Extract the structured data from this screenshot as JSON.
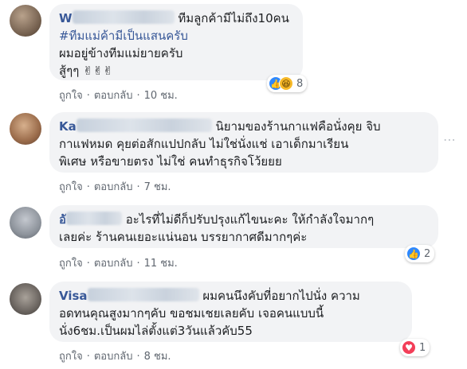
{
  "comments": [
    {
      "name": "W",
      "lines": [
        "ทีมลูกค้ามีไม่ถึง10คน",
        "#ทีมแม่ค้ามีเป็นแสนครับ",
        "ผมอยู่ข้างทีมแม่ยายครับ",
        "สู้ๆๆ ✌✌✌"
      ],
      "actions": {
        "like": "ถูกใจ",
        "reply": "ตอบกลับ",
        "time": "10 ชม."
      },
      "reactions": {
        "icons": [
          "like-icon",
          "haha-icon"
        ],
        "count": "8"
      }
    },
    {
      "name": "Ka",
      "lines": [
        "นิยามของร้านกาแฟคือนั่งคุย จิบ",
        "กาแฟหมด คุยต่อสักแปปกลับ ไม่ใช่นั่งแช่ เอาเด็กมาเรียน",
        "พิเศษ หรือขายตรง ไม่ใช่ คนทำธุรกิจโว้ยยย"
      ],
      "actions": {
        "like": "ถูกใจ",
        "reply": "ตอบกลับ",
        "time": "7 ชม."
      }
    },
    {
      "name": "อั",
      "lines": [
        "อะไรที่ไม่ดีก็ปรับปรุงแก้ไขนะคะ ให้กำลังใจมากๆ",
        "เลยค่ะ ร้านคนเยอะแน่นอน บรรยากาศดีมากๆค่ะ"
      ],
      "actions": {
        "like": "ถูกใจ",
        "reply": "ตอบกลับ",
        "time": "11 ชม."
      },
      "reactions": {
        "icons": [
          "like-icon"
        ],
        "count": "2"
      }
    },
    {
      "name": "Visa",
      "lines": [
        "ผมคนนึงคับที่อยากไปนั่ง ความ",
        "อดทนคุณสูงมากๆคับ ขอชมเชยเลยคับ เจอคนแบบนี้",
        "นั่ง6ชม.เป็นผมไล่ตั้งแต่3วันแล้วคับ55"
      ],
      "actions": {
        "like": "ถูกใจ",
        "reply": "ตอบกลับ",
        "time": "8 ชม."
      },
      "reactions": {
        "icons": [
          "love-icon"
        ],
        "count": "1"
      }
    }
  ],
  "more_icon": "more-dots-icon",
  "colors": {
    "name": "#385898",
    "bubble": "#f2f3f5",
    "like": "#2d88ff",
    "love": "#f33e58",
    "haha": "#f7b928"
  }
}
